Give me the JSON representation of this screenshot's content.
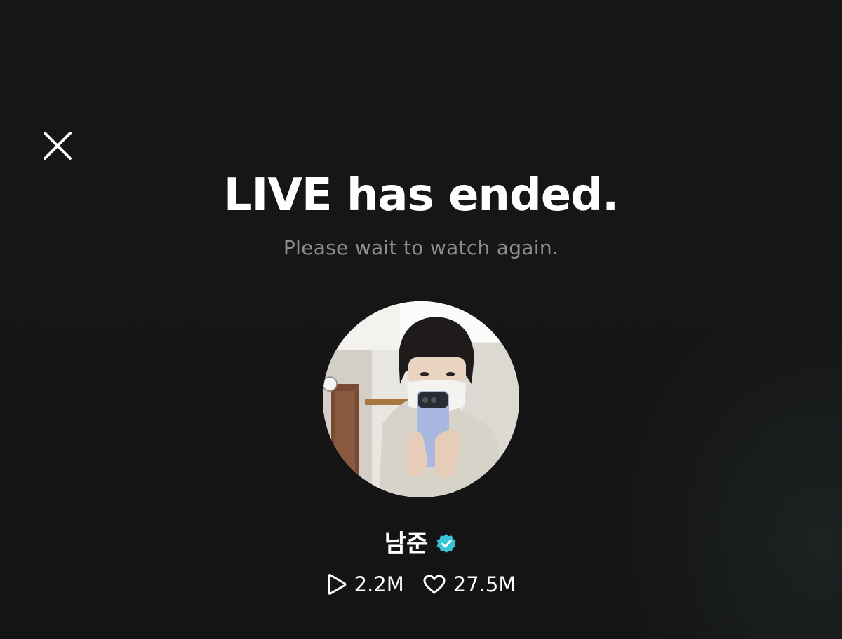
{
  "header": {
    "close_icon": "close-icon"
  },
  "main": {
    "title": "LIVE has ended.",
    "subtitle": "Please wait to watch again."
  },
  "profile": {
    "name": "남준",
    "verified_icon": "verified-badge-icon",
    "avatar_icon": "profile-photo"
  },
  "stats": {
    "plays": "2.2M",
    "plays_icon": "play-icon",
    "likes": "27.5M",
    "likes_icon": "heart-icon"
  },
  "colors": {
    "background": "#151515",
    "title": "#ffffff",
    "subtitle": "#8e8e8e",
    "verified_badge": "#36c5d6"
  }
}
